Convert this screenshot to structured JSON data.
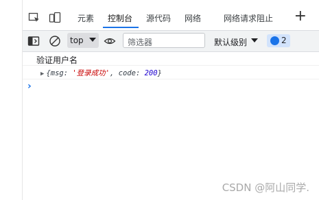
{
  "tabs": [
    {
      "label": "元素"
    },
    {
      "label": "控制台",
      "active": true
    },
    {
      "label": "源代码"
    },
    {
      "label": "网络"
    },
    {
      "label": "网络请求阻止"
    }
  ],
  "new_tab_icon": "plus-icon",
  "toolbar": {
    "context": "top",
    "filter_placeholder": "筛选器",
    "levels": "默认级别",
    "issues_count": "2"
  },
  "console": {
    "log1": "验证用户名",
    "obj_open": "{msg: ",
    "obj_msg": "'登录成功'",
    "obj_mid": ", code: ",
    "obj_code": "200",
    "obj_close": "}"
  },
  "watermark": "CSDN @阿山同学.",
  "colors": {
    "accent": "#1a73e8",
    "toolbar_bg": "#f1f3f4"
  }
}
